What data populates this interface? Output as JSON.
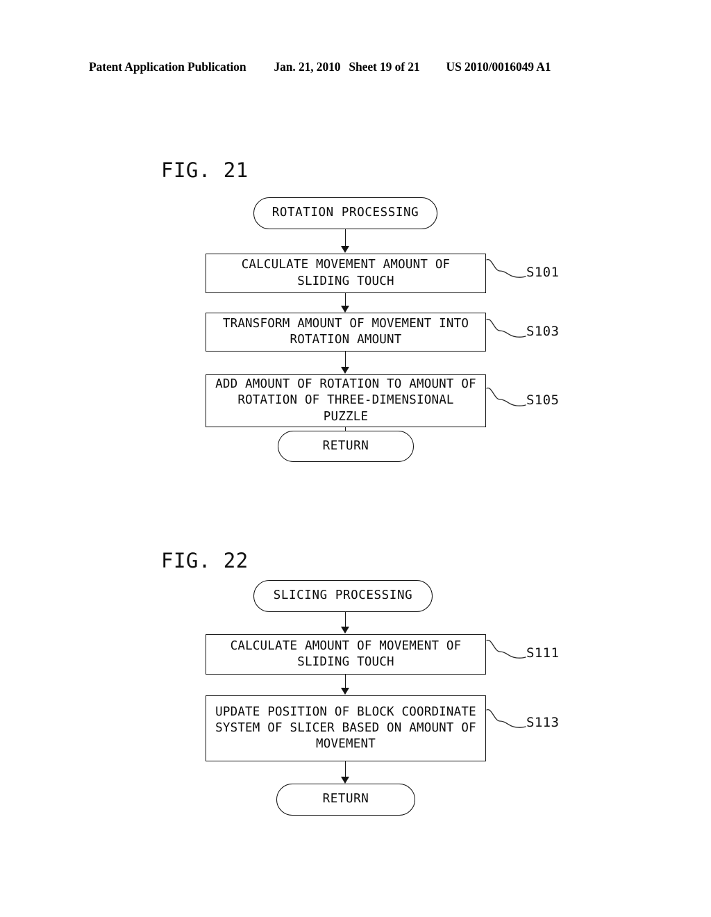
{
  "header": {
    "publication": "Patent Application Publication",
    "date": "Jan. 21, 2010",
    "sheet": "Sheet 19 of 21",
    "patent_number": "US 2010/0016049 A1"
  },
  "figures": [
    {
      "id": "fig-21",
      "title": "FIG. 21",
      "start_label": "ROTATION PROCESSING",
      "end_label": "RETURN",
      "steps": [
        {
          "step": "S101",
          "text": "CALCULATE MOVEMENT AMOUNT OF SLIDING TOUCH"
        },
        {
          "step": "S103",
          "text": "TRANSFORM AMOUNT OF MOVEMENT INTO ROTATION AMOUNT"
        },
        {
          "step": "S105",
          "text": "ADD AMOUNT OF ROTATION TO AMOUNT OF ROTATION OF THREE-DIMENSIONAL PUZZLE"
        }
      ]
    },
    {
      "id": "fig-22",
      "title": "FIG. 22",
      "start_label": "SLICING PROCESSING",
      "end_label": "RETURN",
      "steps": [
        {
          "step": "S111",
          "text": "CALCULATE AMOUNT OF MOVEMENT OF SLIDING TOUCH"
        },
        {
          "step": "S113",
          "text": "UPDATE POSITION OF BLOCK COORDINATE SYSTEM OF SLICER BASED ON AMOUNT OF MOVEMENT"
        }
      ]
    }
  ],
  "colors": {
    "ink": "#111111",
    "paper": "#ffffff"
  }
}
